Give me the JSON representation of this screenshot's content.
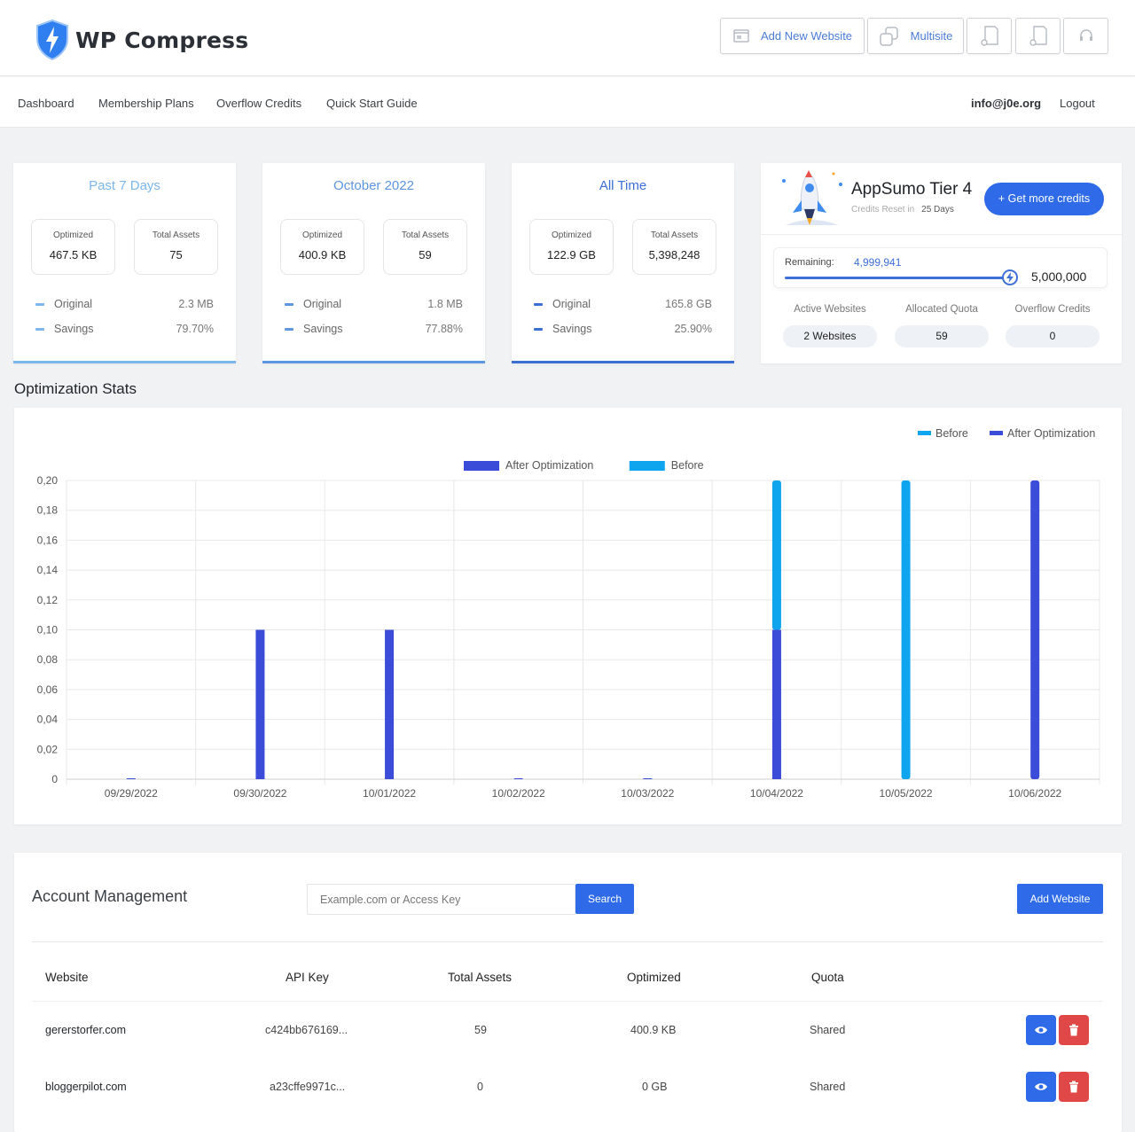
{
  "header": {
    "brand": "WP Compress",
    "buttons": [
      {
        "label": "Add New Website",
        "icon": "website-icon"
      },
      {
        "label": "Multisite",
        "icon": "multisite-icon"
      },
      {
        "label": "",
        "icon": "document-icon"
      },
      {
        "label": "",
        "icon": "document-settings-icon"
      },
      {
        "label": "",
        "icon": "headset-icon"
      }
    ]
  },
  "nav": {
    "items": [
      "Dashboard",
      "Membership Plans",
      "Overflow Credits",
      "Quick Start Guide"
    ],
    "email": "info@j0e.org",
    "logout": "Logout"
  },
  "stats": [
    {
      "title": "Past 7 Days",
      "optimized_label": "Optimized",
      "optimized": "467.5 KB",
      "assets_label": "Total Assets",
      "assets": "75",
      "original_label": "Original",
      "original": "2.3 MB",
      "savings_label": "Savings",
      "savings": "79.70%",
      "accent": "#7cb6ea"
    },
    {
      "title": "October 2022",
      "optimized_label": "Optimized",
      "optimized": "400.9 KB",
      "assets_label": "Total Assets",
      "assets": "59",
      "original_label": "Original",
      "original": "1.8 MB",
      "savings_label": "Savings",
      "savings": "77.88%",
      "accent": "#5d95e0"
    },
    {
      "title": "All Time",
      "optimized_label": "Optimized",
      "optimized": "122.9 GB",
      "assets_label": "Total Assets",
      "assets": "5,398,248",
      "original_label": "Original",
      "original": "165.8 GB",
      "savings_label": "Savings",
      "savings": "25.90%",
      "accent": "#3b6fd4"
    }
  ],
  "plan": {
    "title": "AppSumo Tier 4",
    "reset_label": "Credits Reset in",
    "reset_value": "25 Days",
    "cta": "+ Get more credits",
    "remaining_label": "Remaining:",
    "remaining": "4,999,941",
    "total": "5,000,000",
    "remaining_fraction": 0.99999,
    "active_websites_label": "Active Websites",
    "active_websites": "2 Websites",
    "allocated_quota_label": "Allocated Quota",
    "allocated_quota": "59",
    "overflow_label": "Overflow Credits",
    "overflow": "0"
  },
  "section_title": "Optimization Stats",
  "chart_data": {
    "type": "bar",
    "stacked": true,
    "legend_top_right": [
      "Before",
      "After Optimization"
    ],
    "legend_top_center": [
      "After Optimization",
      "Before"
    ],
    "categories": [
      "09/29/2022",
      "09/30/2022",
      "10/01/2022",
      "10/02/2022",
      "10/03/2022",
      "10/04/2022",
      "10/05/2022",
      "10/06/2022"
    ],
    "series": [
      {
        "name": "After Optimization",
        "color": "#3b4cd9",
        "values": [
          0.0005,
          0.1,
          0.1,
          0.0005,
          0.0005,
          0.1,
          0,
          0.2
        ]
      },
      {
        "name": "Before",
        "color": "#0ea5ee",
        "values": [
          0,
          0,
          0,
          0,
          0,
          0.1,
          0.2,
          0
        ]
      }
    ],
    "ylim": [
      0,
      0.2
    ],
    "yticks": [
      "0",
      "0,02",
      "0,04",
      "0,06",
      "0,08",
      "0,10",
      "0,12",
      "0,14",
      "0,16",
      "0,18",
      "0,20"
    ],
    "grid": true
  },
  "account": {
    "title": "Account Management",
    "search_placeholder": "Example.com or Access Key",
    "search_btn": "Search",
    "add_btn": "Add Website",
    "columns": [
      "Website",
      "API Key",
      "Total Assets",
      "Optimized",
      "Quota"
    ],
    "rows": [
      {
        "website": "gererstorfer.com",
        "api_key": "c424bb676169...",
        "assets": "59",
        "optimized": "400.9 KB",
        "quota": "Shared"
      },
      {
        "website": "bloggerpilot.com",
        "api_key": "a23cffe9971c...",
        "assets": "0",
        "optimized": "0 GB",
        "quota": "Shared"
      }
    ]
  }
}
